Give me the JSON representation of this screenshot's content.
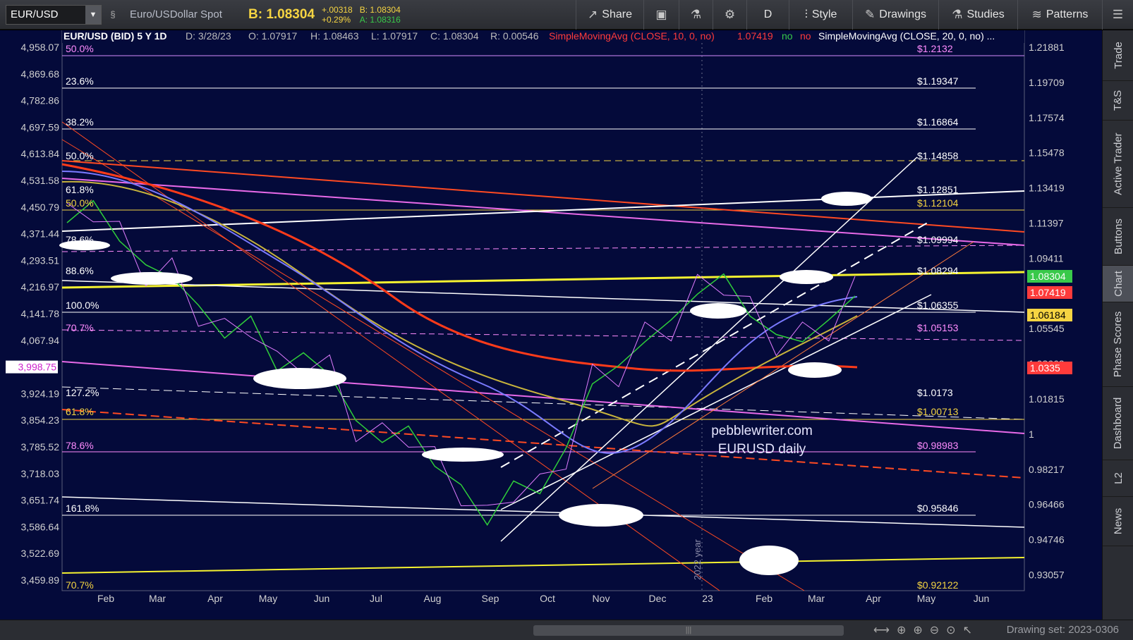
{
  "toolbar": {
    "symbol": "EUR/USD",
    "description": "Euro/USDollar Spot",
    "bid": "B: 1.08304",
    "change": "+.00318",
    "change_pct": "+0.29%",
    "bid_small": "B: 1.08304",
    "ask_small": "A: 1.08316",
    "share_label": "Share",
    "period_label": "D",
    "style_label": "Style",
    "drawings_label": "Drawings",
    "studies_label": "Studies",
    "patterns_label": "Patterns",
    "colors": {
      "bid": "#f5d442",
      "ask": "#39c94a"
    }
  },
  "header": {
    "symbol_info": "EUR/USD (BID) 5 Y 1D",
    "date": "D: 3/28/23",
    "open": "O: 1.07917",
    "high": "H: 1.08463",
    "low": "L: 1.07917",
    "close": "C: 1.08304",
    "range": "R: 0.00546",
    "sma10": "SimpleMovingAvg (CLOSE, 10, 0, no)",
    "sma10_value": "1.07419",
    "sma10_no1": "no",
    "sma10_no2": "no",
    "sma20": "SimpleMovingAvg (CLOSE, 20, 0, no) ...",
    "colors": {
      "sma10": "#ff3b3b",
      "no_green": "#39c94a",
      "no_red": "#ff3b3b"
    }
  },
  "chart_data": {
    "type": "line",
    "title": "",
    "watermark": [
      "pebblewriter.com",
      "EURUSD daily"
    ],
    "year_marker": "2022 year",
    "x_ticks": [
      "Feb",
      "Mar",
      "Apr",
      "May",
      "Jun",
      "Jul",
      "Aug",
      "Sep",
      "Oct",
      "Nov",
      "Dec",
      "23",
      "Feb",
      "Mar",
      "Apr",
      "May",
      "Jun"
    ],
    "left_axis_ticks": [
      "4,958.07",
      "4,869.68",
      "4,782.86",
      "4,697.59",
      "4,613.84",
      "4,531.58",
      "4,450.79",
      "4,371.44",
      "4,293.51",
      "4,216.97",
      "4,141.78",
      "4,067.94",
      "3,998.75",
      "3,924.19",
      "3,854.23",
      "3,785.52",
      "3,718.03",
      "3,651.74",
      "3,586.64",
      "3,522.69",
      "3,459.89"
    ],
    "left_current": "3,998.75",
    "right_axis_ticks": [
      "1.21881",
      "1.19709",
      "1.17574",
      "1.15478",
      "1.13419",
      "1.11397",
      "1.09411",
      "1.05545",
      "1.03663",
      "1.01815",
      "1",
      "0.98217",
      "0.96466",
      "0.94746",
      "0.93057"
    ],
    "right_labels": [
      {
        "text": "1.08304",
        "color": "#39c94a"
      },
      {
        "text": "1.07419",
        "color": "#ff3b3b"
      },
      {
        "text": "1.06184",
        "color": "#f5d442"
      },
      {
        "text": "1.0335",
        "color": "#ff3b3b"
      }
    ],
    "fib_left": [
      {
        "text": "50.0%",
        "color": "#ff8cff"
      },
      {
        "text": "23.6%",
        "color": "#ffffff"
      },
      {
        "text": "38.2%",
        "color": "#ffffff"
      },
      {
        "text": "50.0%",
        "color": "#ffffff"
      },
      {
        "text": "61.8%",
        "color": "#ffffff"
      },
      {
        "text": "50.0%",
        "color": "#f5d442"
      },
      {
        "text": "78.6%",
        "color": "#ffffff"
      },
      {
        "text": "88.6%",
        "color": "#ffffff"
      },
      {
        "text": "100.0%",
        "color": "#ffffff"
      },
      {
        "text": "70.7%",
        "color": "#ff8cff"
      },
      {
        "text": "127.2%",
        "color": "#ffffff"
      },
      {
        "text": "61.8%",
        "color": "#f5d442"
      },
      {
        "text": "78.6%",
        "color": "#ff8cff"
      },
      {
        "text": "161.8%",
        "color": "#ffffff"
      },
      {
        "text": "70.7%",
        "color": "#f5d442"
      }
    ],
    "fib_right": [
      {
        "text": "$1.2132",
        "color": "#ff8cff"
      },
      {
        "text": "$1.19347",
        "color": "#ffffff"
      },
      {
        "text": "$1.16864",
        "color": "#ffffff"
      },
      {
        "text": "$1.14858",
        "color": "#ffffff"
      },
      {
        "text": "$1.12851",
        "color": "#ffffff"
      },
      {
        "text": "$1.12104",
        "color": "#f5d442"
      },
      {
        "text": "$1.09994",
        "color": "#ffffff"
      },
      {
        "text": "$1.08294",
        "color": "#ffffff"
      },
      {
        "text": "$1.06355",
        "color": "#ffffff"
      },
      {
        "text": "$1.05153",
        "color": "#ff8cff"
      },
      {
        "text": "$1.0173",
        "color": "#ffffff"
      },
      {
        "text": "$1.00713",
        "color": "#f5d442"
      },
      {
        "text": "$0.98983",
        "color": "#ff8cff"
      },
      {
        "text": "$0.95846",
        "color": "#ffffff"
      },
      {
        "text": "$0.92122",
        "color": "#f5d442"
      }
    ],
    "series": [
      {
        "values": [
          1.123,
          1.135,
          1.113,
          1.1,
          1.093,
          1.078,
          1.06,
          1.072,
          1.042,
          1.052,
          1.04,
          1.015,
          1.003,
          1.012,
          0.99,
          0.98,
          0.958,
          0.982,
          0.975,
          1.0,
          1.035,
          1.045,
          1.058,
          1.07,
          1.084,
          1.095,
          1.072,
          1.062,
          1.058,
          1.07,
          1.083
        ]
      }
    ]
  },
  "sidebar": {
    "tabs": [
      "Trade",
      "T&S",
      "Active Trader",
      "Buttons",
      "Chart",
      "Phase Scores",
      "Dashboard",
      "L2",
      "News"
    ]
  },
  "bottombar": {
    "drawing_set": "Drawing set: 2023-0306"
  }
}
